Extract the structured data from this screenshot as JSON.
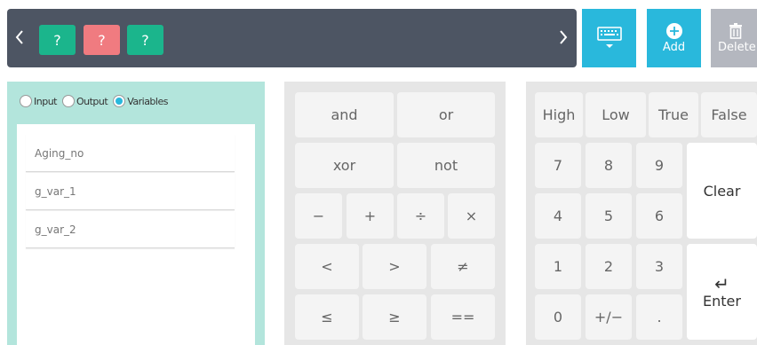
{
  "toolbar": {
    "prev_icon": "chevron-left-icon",
    "next_icon": "chevron-right-icon",
    "slots": [
      {
        "label": "?",
        "color": "#1bb58c"
      },
      {
        "label": "?",
        "color": "#f07b80"
      },
      {
        "label": "?",
        "color": "#1bb58c"
      }
    ],
    "keyboard_icon": "keyboard-icon",
    "add_label": "Add",
    "delete_label": "Delete"
  },
  "source": {
    "options": [
      "Input",
      "Output",
      "Variables"
    ],
    "selected": "Variables"
  },
  "variables": [
    "Aging_no",
    "g_var_1",
    "g_var_2"
  ],
  "operators": {
    "row1": [
      "and",
      "or"
    ],
    "row2": [
      "xor",
      "not"
    ],
    "row3": [
      "−",
      "+",
      "÷",
      "×"
    ],
    "row4": [
      "<",
      ">",
      "≠"
    ],
    "row5": [
      "≤",
      "≥",
      "=="
    ]
  },
  "numpad": {
    "top": [
      "High",
      "Low",
      "True",
      "False"
    ],
    "digits": [
      "7",
      "8",
      "9",
      "4",
      "5",
      "6",
      "1",
      "2",
      "3",
      "0",
      "+/−",
      "."
    ],
    "clear_label": "Clear",
    "enter_symbol": "↵",
    "enter_label": "Enter"
  },
  "colors": {
    "accent": "#29b8dc",
    "toolbar": "#4d5563",
    "panel": "#b3e5dc"
  }
}
